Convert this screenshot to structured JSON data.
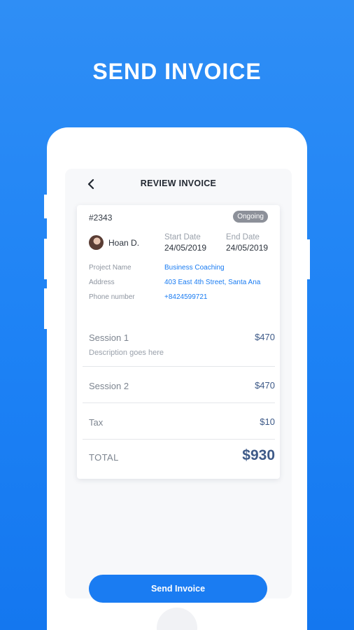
{
  "hero": {
    "title": "SEND INVOICE"
  },
  "header": {
    "title": "REVIEW INVOICE",
    "back_icon": "chevron-left-icon"
  },
  "invoice": {
    "number": "#2343",
    "status": "Ongoing",
    "client_name": "Hoan D.",
    "start_date_label": "Start Date",
    "start_date": "24/05/2019",
    "end_date_label": "End Date",
    "end_date": "24/05/2019",
    "details": [
      {
        "label": "Project Name",
        "value": "Business Coaching"
      },
      {
        "label": "Address",
        "value": "403 East 4th Street, Santa Ana"
      },
      {
        "label": "Phone number",
        "value": "+8424599721"
      }
    ],
    "lines": [
      {
        "name": "Session 1",
        "description": "Description goes here",
        "amount": "$470"
      },
      {
        "name": "Session 2",
        "description": "",
        "amount": "$470"
      },
      {
        "name": "Tax",
        "description": "",
        "amount": "$10"
      }
    ],
    "total_label": "TOTAL",
    "total_amount": "$930"
  },
  "actions": {
    "send_label": "Send Invoice"
  },
  "colors": {
    "background": "#1d82f5",
    "accent": "#1a7cf2",
    "amount": "#3e5a88",
    "badge": "#8c9099"
  }
}
